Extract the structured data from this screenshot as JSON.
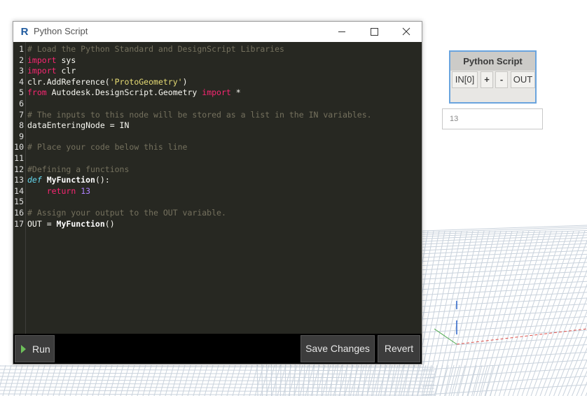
{
  "editor": {
    "title": "Python Script",
    "app_icon_letter": "R",
    "line_numbers": [
      "1",
      "2",
      "3",
      "4",
      "5",
      "6",
      "7",
      "8",
      "9",
      "10",
      "11",
      "12",
      "13",
      "14",
      "15",
      "16",
      "17"
    ],
    "code_lines": [
      [
        {
          "t": "# Load the Python Standard and DesignScript Libraries",
          "c": "comment"
        }
      ],
      [
        {
          "t": "import",
          "c": "keyword"
        },
        {
          "t": " sys",
          "c": "plain"
        }
      ],
      [
        {
          "t": "import",
          "c": "keyword"
        },
        {
          "t": " clr",
          "c": "plain"
        }
      ],
      [
        {
          "t": "clr.AddReference(",
          "c": "plain"
        },
        {
          "t": "'ProtoGeometry'",
          "c": "string"
        },
        {
          "t": ")",
          "c": "plain"
        }
      ],
      [
        {
          "t": "from",
          "c": "keyword"
        },
        {
          "t": " Autodesk.DesignScript.Geometry ",
          "c": "plain"
        },
        {
          "t": "import",
          "c": "keyword"
        },
        {
          "t": " *",
          "c": "plain"
        }
      ],
      [],
      [
        {
          "t": "# The inputs to this node will be stored as a list in the IN variables.",
          "c": "comment"
        }
      ],
      [
        {
          "t": "dataEnteringNode = IN",
          "c": "plain"
        }
      ],
      [],
      [
        {
          "t": "# Place your code below this line",
          "c": "comment"
        }
      ],
      [],
      [
        {
          "t": "#Defining a functions",
          "c": "comment"
        }
      ],
      [
        {
          "t": "def",
          "c": "def"
        },
        {
          "t": " ",
          "c": "plain"
        },
        {
          "t": "MyFunction",
          "c": "func"
        },
        {
          "t": "():",
          "c": "plain"
        }
      ],
      [
        {
          "t": "    ",
          "c": "plain"
        },
        {
          "t": "return",
          "c": "keyword"
        },
        {
          "t": " ",
          "c": "plain"
        },
        {
          "t": "13",
          "c": "number"
        }
      ],
      [],
      [
        {
          "t": "# Assign your output to the OUT variable.",
          "c": "comment"
        }
      ],
      [
        {
          "t": "OUT = ",
          "c": "plain"
        },
        {
          "t": "MyFunction",
          "c": "func"
        },
        {
          "t": "()",
          "c": "plain"
        }
      ]
    ],
    "run_label": "Run",
    "save_label": "Save Changes",
    "revert_label": "Revert"
  },
  "node": {
    "title": "Python Script",
    "input_port": "IN[0]",
    "add_port": "+",
    "remove_port": "-",
    "output_port": "OUT",
    "preview_value": "13"
  },
  "colors": {
    "editor_bg": "#272822",
    "comment": "#75715e",
    "keyword": "#f92672",
    "string": "#e6db74",
    "number": "#ae81ff",
    "node_selection": "#6aa4de"
  }
}
